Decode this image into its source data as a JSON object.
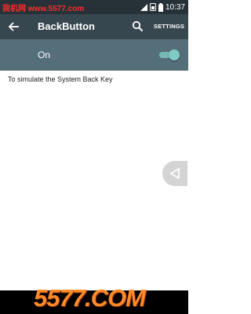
{
  "status_bar": {
    "watermark": "我机网 www.5577.com",
    "time": "10:37",
    "icons": [
      "signal-icon",
      "sim-icon",
      "battery-icon"
    ]
  },
  "app_bar": {
    "title": "BackButton",
    "settings_label": "SETTINGS",
    "icons": [
      "back-arrow-icon",
      "search-icon"
    ]
  },
  "switch_bar": {
    "label": "On",
    "checked": true
  },
  "content": {
    "description": "To simulate the System Back Key"
  },
  "floating_button": {
    "icon": "triangle-back-icon"
  },
  "watermark_bottom": "5577.COM",
  "colors": {
    "status_bar": "#263238",
    "app_bar": "#37474f",
    "switch_bar": "#546e7a",
    "accent": "#80cbc4"
  }
}
